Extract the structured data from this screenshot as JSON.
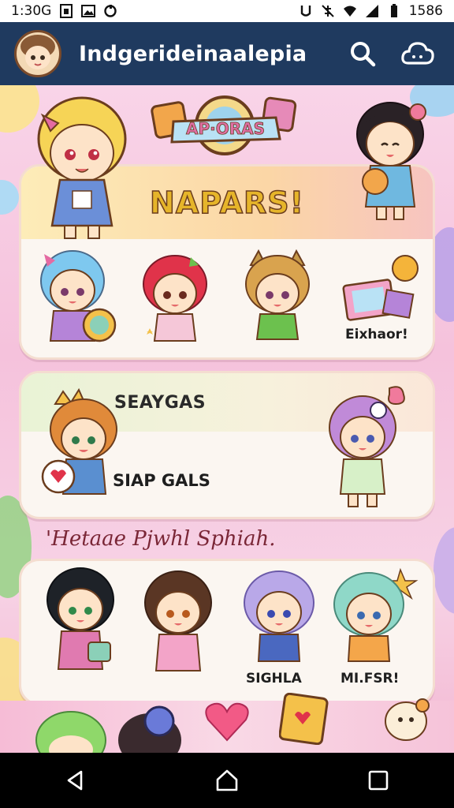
{
  "status_bar": {
    "time": "1:30G",
    "right_text": "1586",
    "icons": [
      "sim-icon",
      "image-icon",
      "sync-icon",
      "vibrate-icon",
      "mute-icon",
      "wifi-icon",
      "signal-icon",
      "battery-icon"
    ]
  },
  "app_bar": {
    "title": "Indgerideinaalepia",
    "actions": [
      "search-icon",
      "cloud-icon"
    ]
  },
  "banner_sign": {
    "text": "AP·ORAS"
  },
  "section_one": {
    "title": "NAPARS!",
    "item_label": "Eixhaor!"
  },
  "section_two": {
    "title": "SEAYGAS",
    "subtitle": "SIAP GALS"
  },
  "script_line": "'Hetaae Pjwhl Sphiah.",
  "gallery": {
    "captions": [
      "SIGHLA",
      "MI.FSR!"
    ]
  },
  "colors": {
    "app_bar": "#1f3a5f",
    "heading_fill": "#e6b52a",
    "background": "#f7c9e0",
    "card": "#fbf6f1"
  },
  "nav": {
    "buttons": [
      "back-icon",
      "home-icon",
      "recents-icon"
    ]
  }
}
